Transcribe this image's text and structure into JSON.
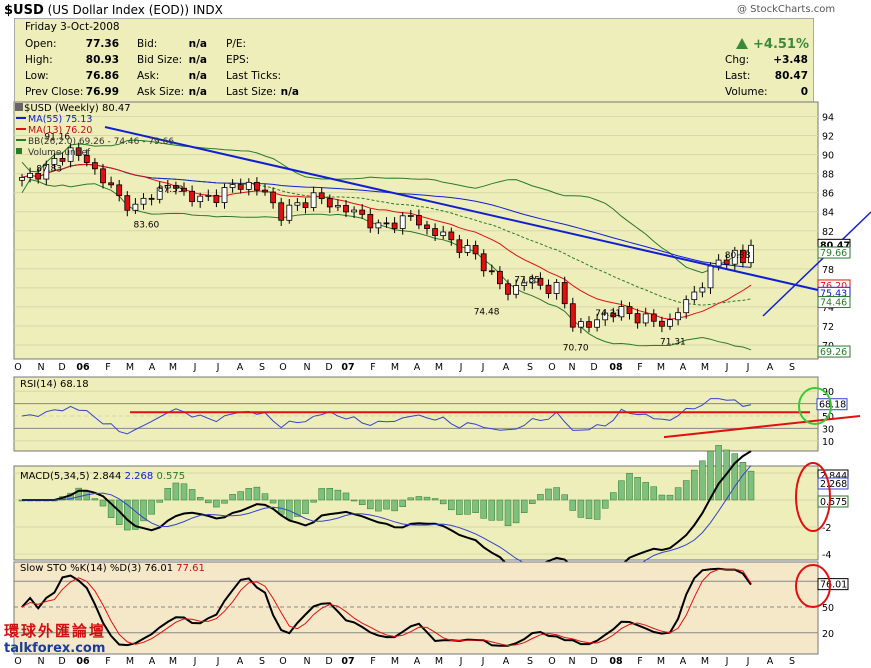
{
  "header": {
    "symbol": "$USD",
    "name": "(US Dollar Index (EOD))",
    "exchange": "INDX",
    "copyright": "@ StockCharts.com"
  },
  "quote": {
    "date": "Friday   3-Oct-2008",
    "open_label": "Open:",
    "open": "77.36",
    "high_label": "High:",
    "high": "80.93",
    "low_label": "Low:",
    "low": "76.86",
    "prev_label": "Prev Close:",
    "prev": "76.99",
    "bid_label": "Bid:",
    "bid": "n/a",
    "bidsize_label": "Bid Size:",
    "bidsize": "n/a",
    "ask_label": "Ask:",
    "ask": "n/a",
    "asksize_label": "Ask Size:",
    "asksize": "n/a",
    "pe_label": "P/E:",
    "eps_label": "EPS:",
    "lastticks_label": "Last Ticks:",
    "lastsize_label": "Last Size:",
    "lastsize": "n/a",
    "pct_change": "+4.51%",
    "chg_label": "Chg:",
    "chg": "+3.48",
    "last_label": "Last:",
    "last": "80.47",
    "volume_label": "Volume:",
    "volume": "0"
  },
  "colors": {
    "panel_bg": "#eeeebb",
    "up_color": "#3a8a3a",
    "trend_blue": "#1020d0",
    "red": "#e01010",
    "green_band": "#2a7a2a"
  },
  "legend": {
    "price": "$USD (Weekly) 80.47",
    "ma55": "MA(55) 75.13",
    "ma13": "MA(13) 76.20",
    "bb_prefix": "BB(26,2.0) 69.26 - 74.46 - 79.66",
    "volume": "Volume undef",
    "rsi": "RSI(14) 68.18",
    "macd_name": "MACD(5,34,5)",
    "macd_v1": "2.844",
    "macd_v2": "2.268",
    "macd_v3": "0.575",
    "sto_name": "Slow STO %K(14) %D(3)",
    "sto_k": "76.01",
    "sto_d": "77.61"
  },
  "chart_data": {
    "type": "candlestick",
    "title": "$USD (US Dollar Index (EOD)) INDX",
    "ylim": [
      69,
      95
    ],
    "y_ticks": [
      "94",
      "92",
      "90",
      "88",
      "86",
      "84",
      "82",
      "80",
      "78",
      "76",
      "74",
      "72",
      "70"
    ],
    "price_labels": [
      "80.47",
      "79.66",
      "76.20",
      "75.43",
      "74.46",
      "69.26"
    ],
    "x_ticks": [
      "O",
      "N",
      "D",
      "06",
      "F",
      "M",
      "A",
      "M",
      "J",
      "J",
      "A",
      "S",
      "O",
      "N",
      "D",
      "07",
      "F",
      "M",
      "A",
      "M",
      "J",
      "J",
      "A",
      "S",
      "O",
      "N",
      "D",
      "08",
      "F",
      "M",
      "A",
      "M",
      "J",
      "J",
      "A",
      "S"
    ],
    "annotations": [
      {
        "label": "91.16",
        "week": 4,
        "value": 91.16
      },
      {
        "label": "87.83",
        "week": 3,
        "value": 87.83
      },
      {
        "label": "87.33",
        "week": 18,
        "value": 87.33
      },
      {
        "label": "83.60",
        "week": 15,
        "value": 83.6
      },
      {
        "label": "77.85",
        "week": 62,
        "value": 77.85
      },
      {
        "label": "74.48",
        "week": 57,
        "value": 74.48
      },
      {
        "label": "74.31",
        "week": 72,
        "value": 74.31
      },
      {
        "label": "70.70",
        "week": 68,
        "value": 70.7
      },
      {
        "label": "71.31",
        "week": 80,
        "value": 71.31
      },
      {
        "label": "80.38",
        "week": 88,
        "value": 80.38
      }
    ],
    "close_keypoints": [
      [
        0,
        87.3
      ],
      [
        3,
        88.6
      ],
      [
        6,
        90.5
      ],
      [
        8,
        89.2
      ],
      [
        10,
        87.5
      ],
      [
        12,
        85.4
      ],
      [
        14,
        84.4
      ],
      [
        16,
        85.8
      ],
      [
        18,
        86.8
      ],
      [
        20,
        86.0
      ],
      [
        22,
        85.2
      ],
      [
        24,
        85.7
      ],
      [
        26,
        86.6
      ],
      [
        28,
        86.9
      ],
      [
        30,
        85.9
      ],
      [
        32,
        83.7
      ],
      [
        34,
        84.7
      ],
      [
        36,
        85.6
      ],
      [
        38,
        84.8
      ],
      [
        40,
        84.2
      ],
      [
        42,
        83.6
      ],
      [
        44,
        82.3
      ],
      [
        46,
        82.9
      ],
      [
        48,
        83.5
      ],
      [
        50,
        82.1
      ],
      [
        52,
        81.5
      ],
      [
        54,
        80.4
      ],
      [
        56,
        79.4
      ],
      [
        58,
        77.4
      ],
      [
        60,
        75.4
      ],
      [
        62,
        76.9
      ],
      [
        64,
        76.2
      ],
      [
        66,
        76.0
      ],
      [
        68,
        72.4
      ],
      [
        70,
        71.9
      ],
      [
        72,
        73.3
      ],
      [
        74,
        73.5
      ],
      [
        76,
        73.0
      ],
      [
        78,
        72.4
      ],
      [
        80,
        72.4
      ],
      [
        82,
        74.6
      ],
      [
        84,
        76.5
      ],
      [
        86,
        78.9
      ],
      [
        88,
        79.4
      ],
      [
        89,
        78.6
      ],
      [
        90,
        80.47
      ]
    ],
    "rsi": {
      "ylim": [
        0,
        100
      ],
      "ticks": [
        "90",
        "70",
        "50",
        "30",
        "10"
      ],
      "last": 68.18
    },
    "macd": {
      "ylim": [
        -5.5,
        4.5
      ],
      "ticks": [
        "2",
        "0",
        "-2",
        "-4"
      ],
      "labels": [
        "2.844",
        "2.268",
        "0.575"
      ]
    },
    "slow_sto": {
      "ylim": [
        0,
        100
      ],
      "ticks": [
        "80",
        "50",
        "20"
      ],
      "labels": [
        "76.01"
      ]
    }
  }
}
